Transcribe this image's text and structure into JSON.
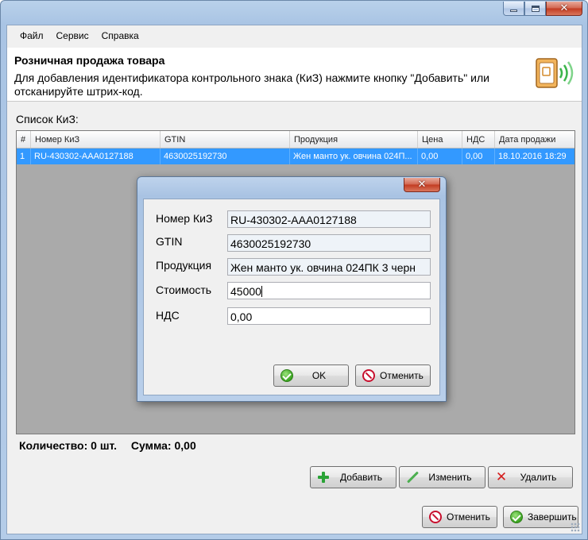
{
  "window": {
    "caption_buttons": [
      "minimize-icon",
      "maximize-icon",
      "close-icon"
    ],
    "close_glyph": "✕"
  },
  "menu": {
    "items": [
      {
        "label": "Файл"
      },
      {
        "label": "Сервис"
      },
      {
        "label": "Справка"
      }
    ]
  },
  "header": {
    "title": "Розничная продажа товара",
    "description": "Для добавления идентификатора контрольного знака (КиЗ) нажмите кнопку \"Добавить\" или отсканируйте штрих-код.",
    "icon": "rfid-tag-icon"
  },
  "list": {
    "label": "Список КиЗ:",
    "columns": [
      "#",
      "Номер КиЗ",
      "GTIN",
      "Продукция",
      "Цена",
      "НДС",
      "Дата продажи"
    ],
    "rows": [
      {
        "num": "1",
        "kiz": "RU-430302-AAA0127188",
        "gtin": "4630025192730",
        "product": "Жен манто ук. овчина 024П...",
        "price": "0,00",
        "vat": "0,00",
        "date": "18.10.2016 18:29",
        "selected": true
      }
    ],
    "selection_color": "#3399ff"
  },
  "totals": {
    "quantity": "Количество: 0 шт.",
    "sum": "Сумма: 0,00"
  },
  "actions": {
    "add_label": "Добавить",
    "edit_label": "Изменить",
    "delete_label": "Удалить"
  },
  "footer": {
    "cancel_label": "Отменить",
    "finish_label": "Завершить"
  },
  "dialog": {
    "fields": {
      "kiz_label": "Номер КиЗ",
      "kiz_value": "RU-430302-AAA0127188",
      "gtin_label": "GTIN",
      "gtin_value": "4630025192730",
      "product_label": "Продукция",
      "product_value": "Жен манто ук. овчина 024ПК 3 черн",
      "cost_label": "Стоимость",
      "cost_value": "45000",
      "vat_label": "НДС",
      "vat_value": "0,00"
    },
    "ok_label": "OK",
    "cancel_label": "Отменить"
  }
}
